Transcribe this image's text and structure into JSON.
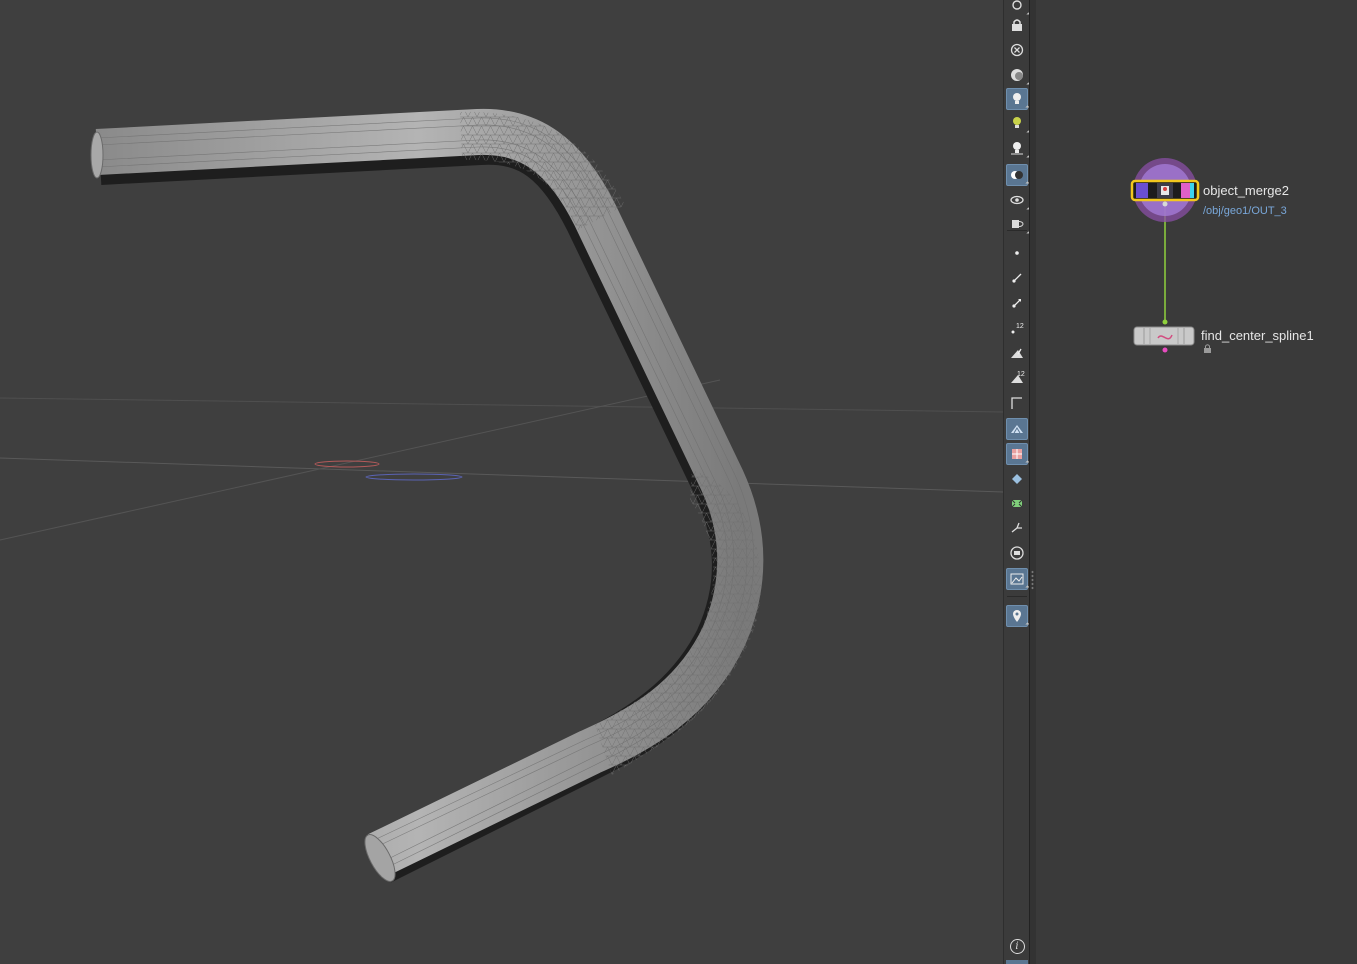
{
  "viewport": {
    "name": "3D Scene View",
    "object": "bent tube geometry"
  },
  "toolbar": {
    "buttons": [
      {
        "name": "display-options-icon"
      },
      {
        "name": "lock-camera-icon"
      },
      {
        "name": "remove-icon"
      },
      {
        "name": "shading-mode-icon"
      },
      {
        "name": "headlight-icon"
      },
      {
        "name": "normal-light-icon"
      },
      {
        "name": "high-quality-light-icon"
      },
      {
        "name": "ambient-occlusion-icon"
      },
      {
        "name": "ghost-objects-icon"
      },
      {
        "name": "hide-objects-icon"
      },
      {
        "name": "point-display-icon"
      },
      {
        "name": "point-normals-icon"
      },
      {
        "name": "point-velocity-icon"
      },
      {
        "name": "point-numbers-icon"
      },
      {
        "name": "primitive-normals-icon"
      },
      {
        "name": "primitive-numbers-icon"
      },
      {
        "name": "uv-display-icon"
      },
      {
        "name": "shaded-wireframe-icon"
      },
      {
        "name": "texture-display-icon"
      },
      {
        "name": "template-display-icon"
      },
      {
        "name": "guide-display-icon"
      },
      {
        "name": "origin-icon"
      },
      {
        "name": "backface-icon"
      },
      {
        "name": "background-image-icon"
      },
      {
        "name": "snapshot-pin-icon"
      }
    ],
    "info_label": "i"
  },
  "network": {
    "nodes": [
      {
        "name": "object_merge2",
        "path": "/obj/geo1/OUT_3"
      },
      {
        "name": "find_center_spline1"
      }
    ],
    "colors": {
      "wire": "#8fd13c",
      "display_flag": "#d58cf0",
      "highlight": "#f2c81e"
    }
  }
}
